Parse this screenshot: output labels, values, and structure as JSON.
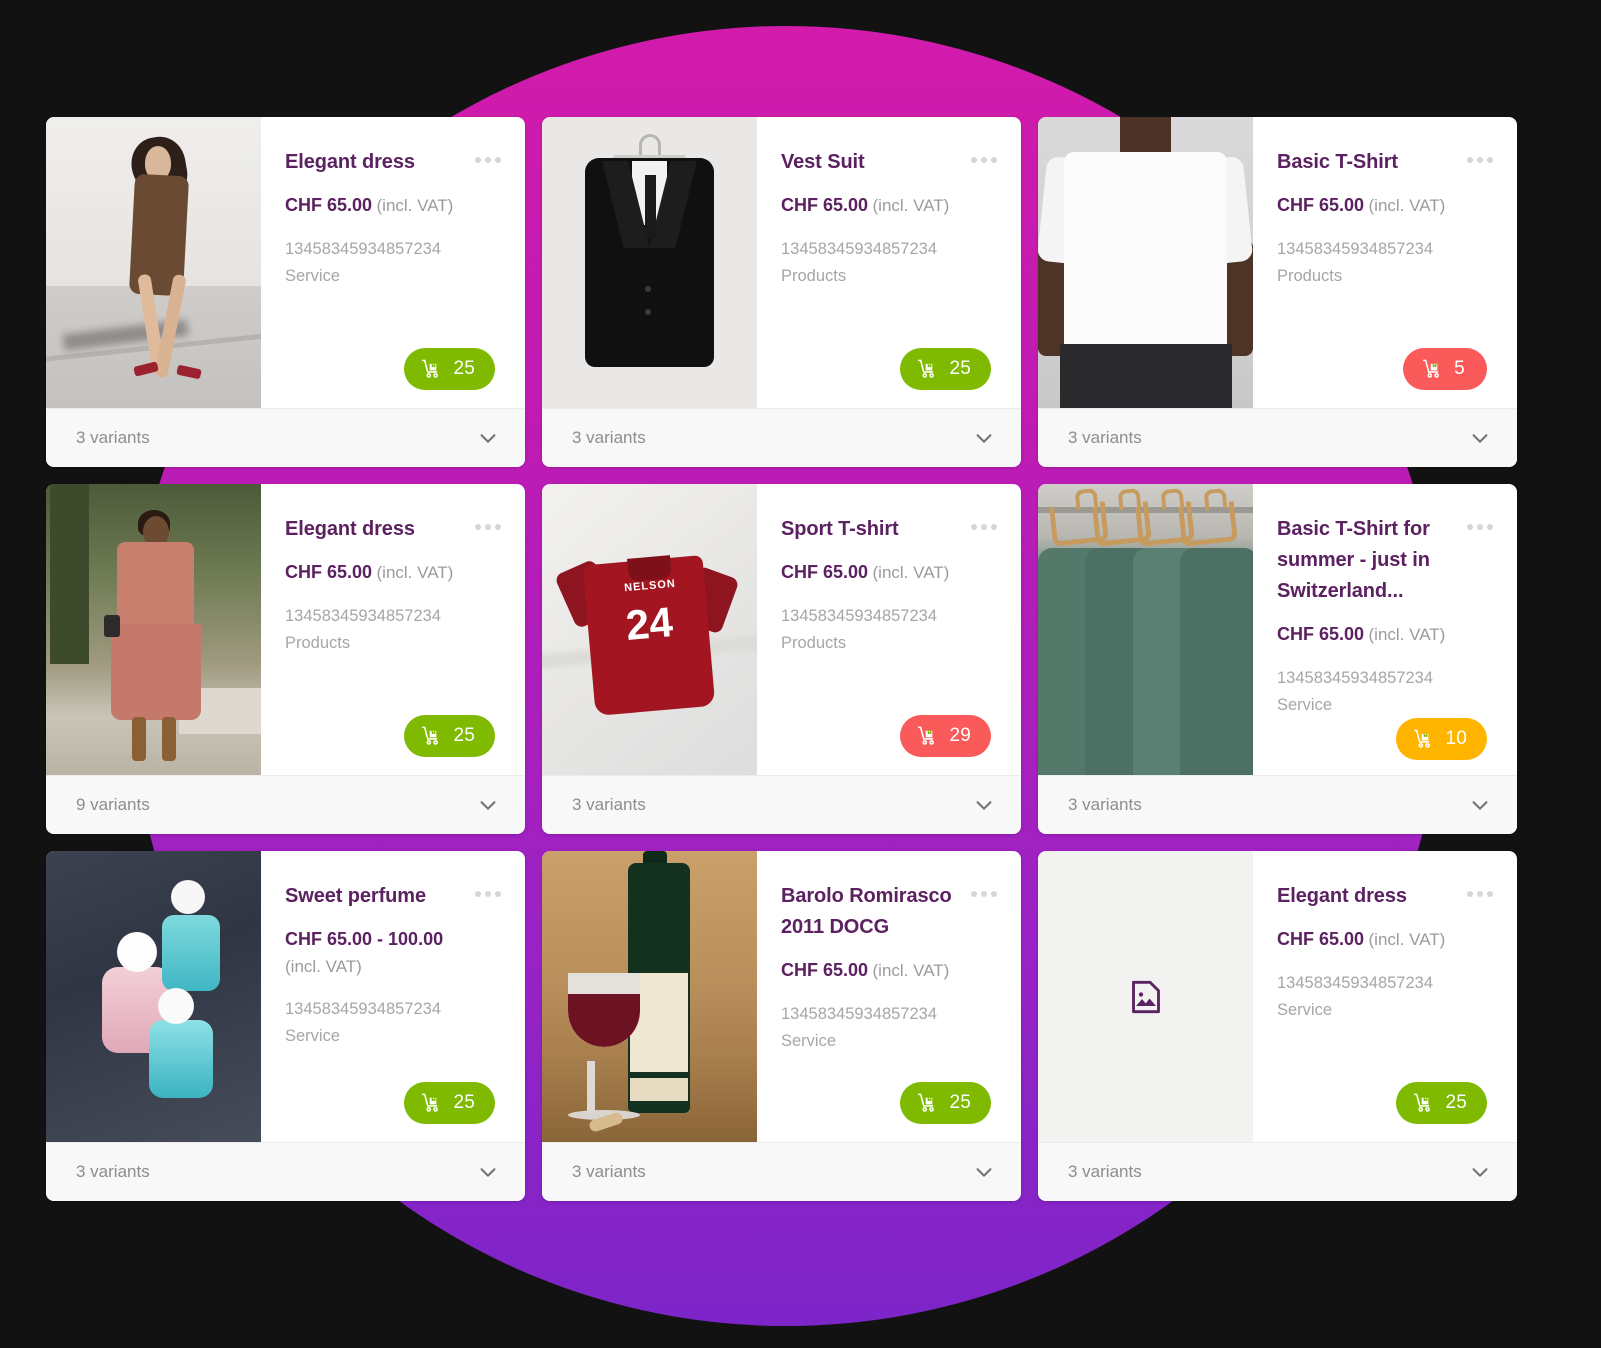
{
  "theme": {
    "background": "#121212",
    "blob_gradient_top": "#d21bab",
    "blob_gradient_bottom": "#7d25c9",
    "card_background": "#ffffff",
    "title_color": "#5b2161",
    "muted_color": "#a6a6a6",
    "footer_background": "#f8f8f8",
    "stock_high_color": "#7fba00",
    "stock_low_color": "#fa5a5a",
    "stock_medium_color": "#ffb400"
  },
  "labels": {
    "vat_note": "(incl. VAT)",
    "more_menu": "more-options",
    "expand": "expand-variants"
  },
  "cards": [
    {
      "title": "Elegant dress",
      "price": "CHF 65.00",
      "vat": "(incl. VAT)",
      "sku": "13458345934857234",
      "category": "Service",
      "stock": "25",
      "stock_level": "high",
      "variants": "3 variants",
      "image": "art-dress-brown",
      "has_image": true
    },
    {
      "title": "Vest Suit",
      "price": "CHF 65.00",
      "vat": "(incl. VAT)",
      "sku": "13458345934857234",
      "category": "Products",
      "stock": "25",
      "stock_level": "high",
      "variants": "3 variants",
      "image": "art-suit",
      "has_image": true
    },
    {
      "title": "Basic T-Shirt",
      "price": "CHF 65.00",
      "vat": "(incl. VAT)",
      "sku": "13458345934857234",
      "category": "Products",
      "stock": "5",
      "stock_level": "low",
      "variants": "3 variants",
      "image": "art-tshirt-white",
      "has_image": true
    },
    {
      "title": "Elegant dress",
      "price": "CHF 65.00",
      "vat": "(incl. VAT)",
      "sku": "13458345934857234",
      "category": "Products",
      "stock": "25",
      "stock_level": "high",
      "variants": "9 variants",
      "image": "art-dress-pink",
      "has_image": true
    },
    {
      "title": "Sport T-shirt",
      "price": "CHF 65.00",
      "vat": "(incl. VAT)",
      "sku": "13458345934857234",
      "category": "Products",
      "stock": "29",
      "stock_level": "low",
      "variants": "3 variants",
      "image": "art-jersey",
      "jersey_name": "NELSON",
      "jersey_number": "24",
      "has_image": true
    },
    {
      "title": "Basic T-Shirt for summer - just in Switzerland...",
      "price": "CHF 65.00",
      "vat": "(incl. VAT)",
      "sku": "13458345934857234",
      "category": "Service",
      "stock": "10",
      "stock_level": "medium",
      "variants": "3 variants",
      "image": "art-hangers",
      "has_image": true
    },
    {
      "title": "Sweet perfume",
      "price": "CHF 65.00 - 100.00",
      "vat": "(incl. VAT)",
      "price_stacked": true,
      "sku": "13458345934857234",
      "category": "Service",
      "stock": "25",
      "stock_level": "high",
      "variants": "3 variants",
      "image": "art-perfume",
      "has_image": true
    },
    {
      "title": "Barolo Romirasco 2011 DOCG",
      "price": "CHF 65.00",
      "vat": "(incl. VAT)",
      "sku": "13458345934857234",
      "category": "Service",
      "stock": "25",
      "stock_level": "high",
      "variants": "3 variants",
      "image": "art-wine",
      "has_image": true
    },
    {
      "title": "Elegant dress",
      "price": "CHF 65.00",
      "vat": "(incl. VAT)",
      "sku": "13458345934857234",
      "category": "Service",
      "stock": "25",
      "stock_level": "high",
      "variants": "3 variants",
      "image": "placeholder",
      "has_image": false
    }
  ]
}
